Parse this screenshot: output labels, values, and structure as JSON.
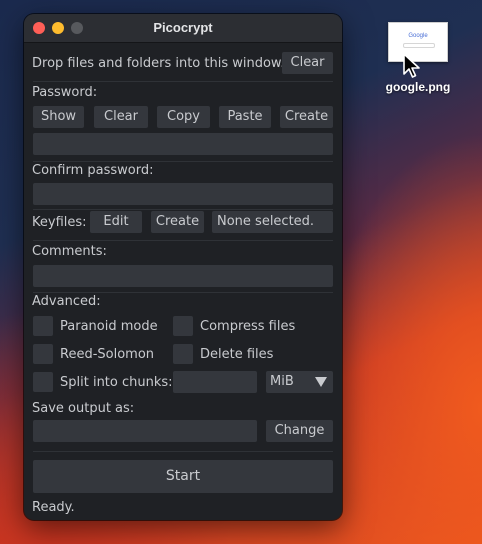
{
  "window": {
    "title": "Picocrypt"
  },
  "drop": {
    "text": "Drop files and folders into this window.",
    "clear_label": "Clear"
  },
  "password": {
    "label": "Password:",
    "buttons": {
      "show": "Show",
      "clear": "Clear",
      "copy": "Copy",
      "paste": "Paste",
      "create": "Create"
    },
    "value": ""
  },
  "confirm": {
    "label": "Confirm password:",
    "value": ""
  },
  "keyfiles": {
    "label": "Keyfiles:",
    "edit_label": "Edit",
    "create_label": "Create",
    "status": "None selected."
  },
  "comments": {
    "label": "Comments:",
    "value": ""
  },
  "advanced": {
    "label": "Advanced:",
    "paranoid": {
      "label": "Paranoid mode",
      "checked": false
    },
    "compress": {
      "label": "Compress files",
      "checked": false
    },
    "reed": {
      "label": "Reed-Solomon",
      "checked": false
    },
    "delete": {
      "label": "Delete files",
      "checked": false
    },
    "split": {
      "label": "Split into chunks:",
      "checked": false,
      "size": "",
      "unit": "MiB"
    }
  },
  "save": {
    "label": "Save output as:",
    "value": "",
    "change_label": "Change"
  },
  "start": {
    "label": "Start"
  },
  "status": {
    "text": "Ready."
  },
  "desktop": {
    "file_name": "google.png",
    "thumb_text": "Google"
  }
}
